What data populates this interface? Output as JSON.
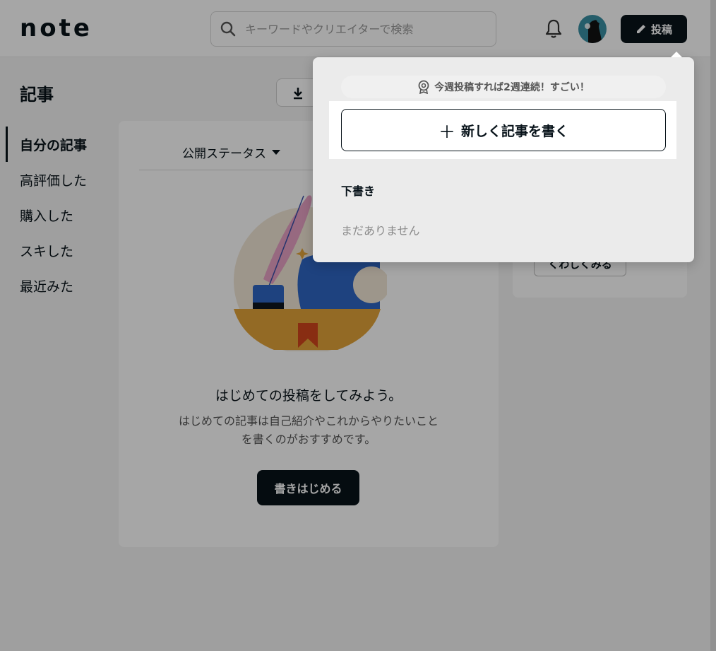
{
  "header": {
    "logo": "note",
    "search_placeholder": "キーワードやクリエイターで検索",
    "post_button": "投稿"
  },
  "page": {
    "title": "記事"
  },
  "sidebar": {
    "items": [
      {
        "label": "自分の記事",
        "active": true
      },
      {
        "label": "高評価した",
        "active": false
      },
      {
        "label": "購入した",
        "active": false
      },
      {
        "label": "スキした",
        "active": false
      },
      {
        "label": "最近みた",
        "active": false
      }
    ]
  },
  "main": {
    "filter_label": "公開ステータス",
    "empty_title": "はじめての投稿をしてみよう。",
    "empty_desc_line1": "はじめての記事は自己紹介やこれからやりたいこと",
    "empty_desc_line2": "を書くのがおすすめです。",
    "start_button": "書きはじめる"
  },
  "right_panel": {
    "detail_button": "くわしくみる"
  },
  "dropdown": {
    "streak_text": "今週投稿すれば2週連続！すごい！",
    "new_post_button": "新しく記事を書く",
    "drafts_title": "下書き",
    "drafts_empty": "まだありません"
  },
  "colors": {
    "primary": "#08131a",
    "avatar": "#3a8fa3"
  }
}
